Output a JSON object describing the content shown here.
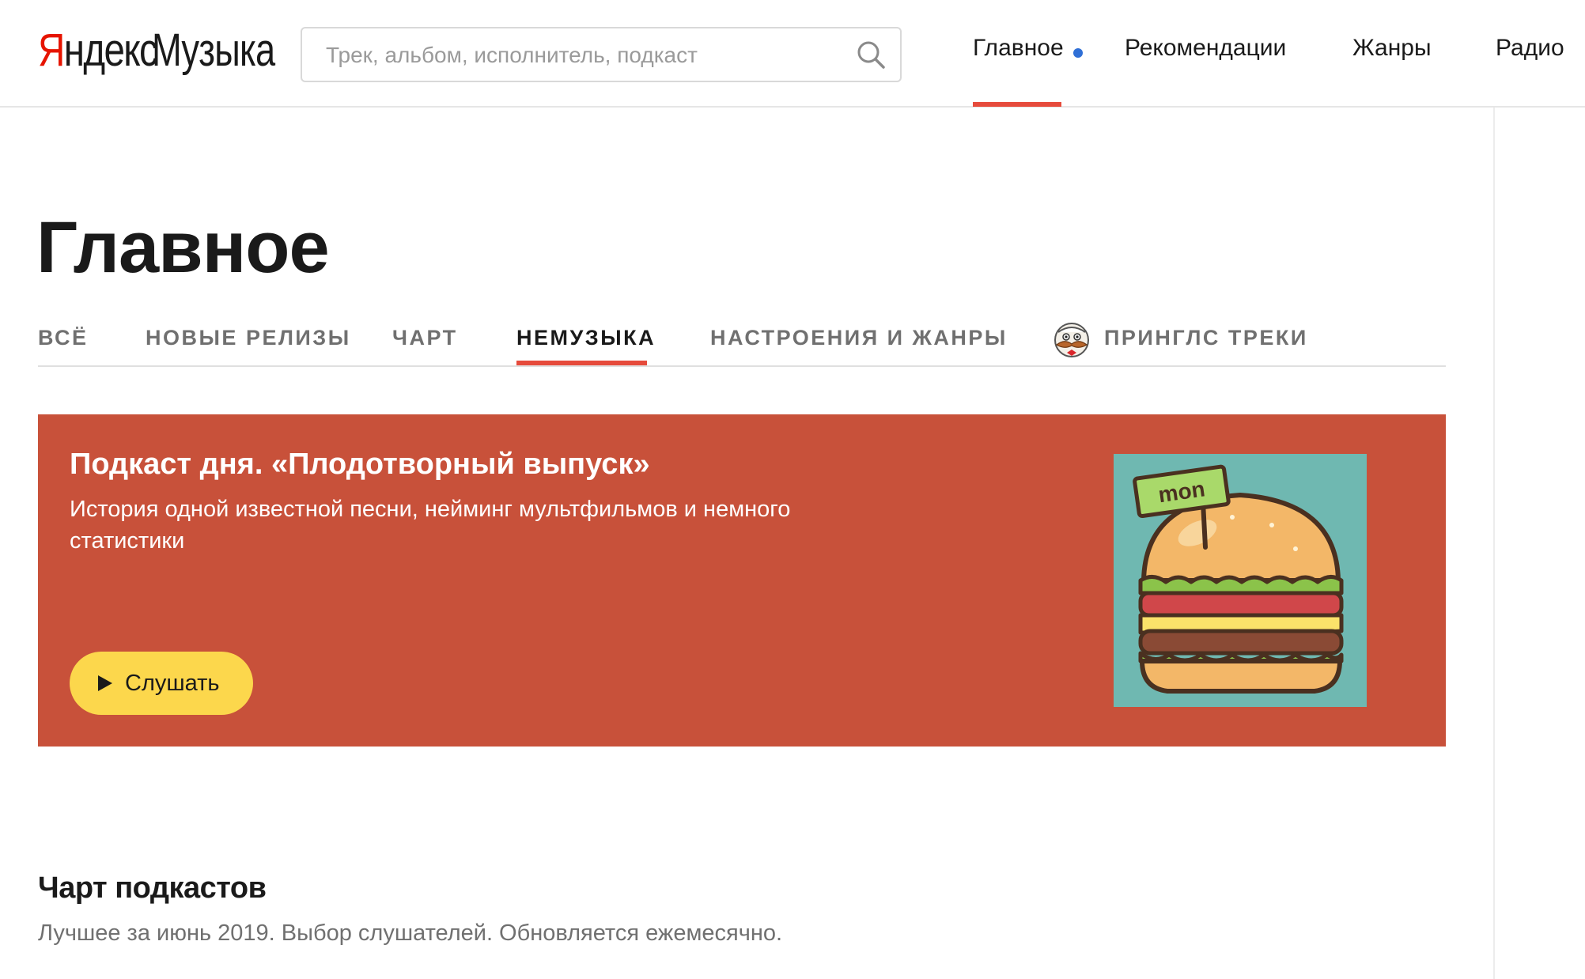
{
  "header": {
    "logo": {
      "part1_first": "Я",
      "part1_rest": "ндекс",
      "part2": "Музыка"
    },
    "search": {
      "placeholder": "Трек, альбом, исполнитель, подкаст",
      "value": ""
    },
    "nav": [
      {
        "label": "Главное",
        "active": true,
        "has_dot": true
      },
      {
        "label": "Рекомендации"
      },
      {
        "label": "Жанры"
      },
      {
        "label": "Радио"
      }
    ]
  },
  "page": {
    "title": "Главное"
  },
  "tabs": [
    {
      "label": "Всё"
    },
    {
      "label": "Новые релизы"
    },
    {
      "label": "Чарт"
    },
    {
      "label": "Немузыка",
      "active": true
    },
    {
      "label": "Настроения и жанры"
    },
    {
      "label": "Принглс треки",
      "icon": "pringles-mascot-icon"
    }
  ],
  "banner": {
    "title": "Подкаст дня. «Плодотворный выпуск»",
    "description": "История одной известной песни, нейминг мультфильмов и немного статистики",
    "button_label": "Слушать",
    "cover_sign_text": "mon",
    "background_color": "#c8513a",
    "button_color": "#fcd74c"
  },
  "chart_section": {
    "title": "Чарт подкастов",
    "subtitle": "Лучшее за июнь 2019. Выбор слушателей. Обновляется ежемесячно."
  },
  "colors": {
    "accent_red": "#e64b3c",
    "logo_red": "#e61400",
    "nav_dot_blue": "#2f6fd6"
  }
}
